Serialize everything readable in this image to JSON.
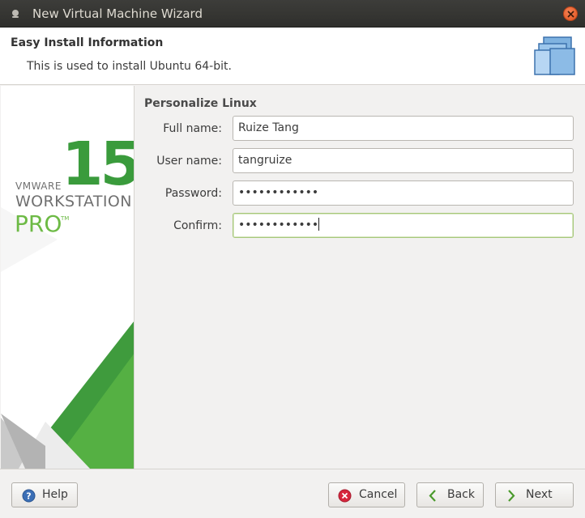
{
  "window": {
    "title": "New Virtual Machine Wizard",
    "close_icon": "close-icon"
  },
  "header": {
    "title": "Easy Install Information",
    "subtitle": "This is used to install Ubuntu 64-bit.",
    "icon": "virtual-machines-icon"
  },
  "sidebar": {
    "brand_vmware": "VMWARE",
    "brand_workstation": "WORKSTATION",
    "brand_pro": "PRO",
    "brand_tm": "TM",
    "brand_version": "15",
    "accent_green": "#3a9b3c"
  },
  "form": {
    "section_title": "Personalize Linux",
    "fields": [
      {
        "label": "Full name:",
        "value": "Ruize Tang"
      },
      {
        "label": "User name:",
        "value": "tangruize"
      },
      {
        "label": "Password:",
        "value": "••••••••••••"
      },
      {
        "label": "Confirm:",
        "value": "••••••••••••"
      }
    ]
  },
  "footer": {
    "help_label": "Help",
    "cancel_label": "Cancel",
    "back_label": "Back",
    "next_label": "Next"
  }
}
